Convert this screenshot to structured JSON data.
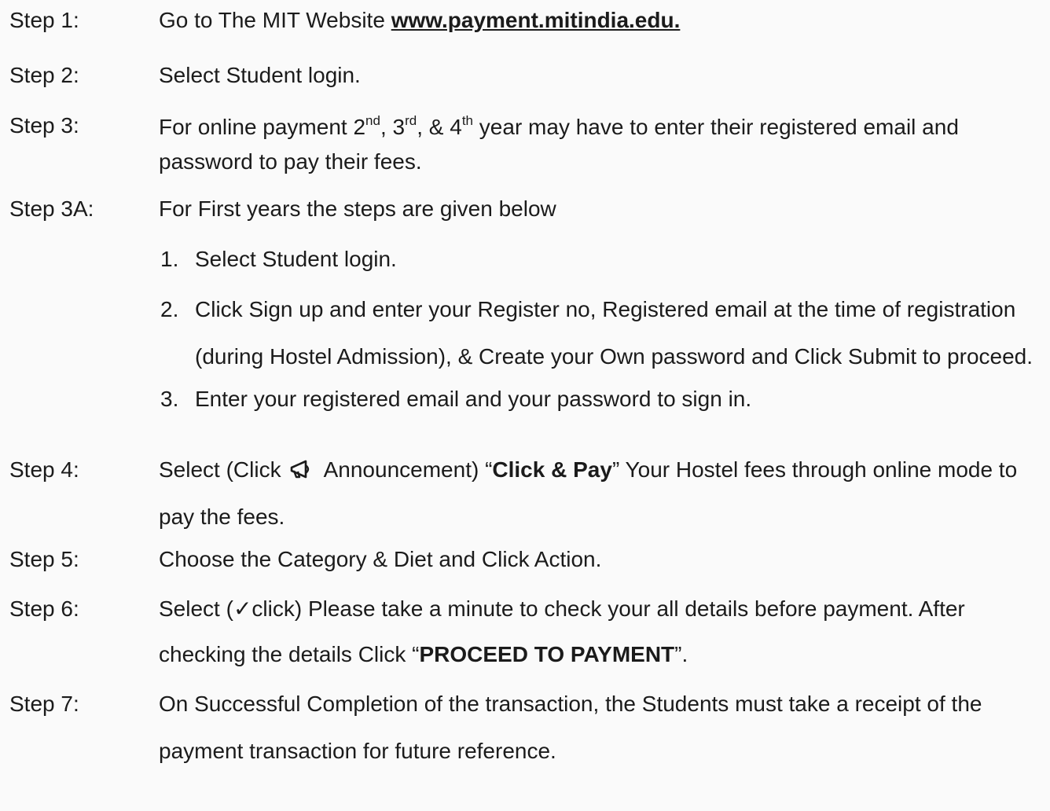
{
  "steps": {
    "s1": {
      "label": "Step 1:",
      "text_before": "Go to The MIT Website ",
      "link": "www.payment.mitindia.edu."
    },
    "s2": {
      "label": "Step 2:",
      "text": "Select Student login."
    },
    "s3": {
      "label": "Step 3:",
      "part1": "For online payment 2",
      "sup1": "nd",
      "part2": ", 3",
      "sup2": "rd",
      "part3": ", & 4",
      "sup3": "th",
      "part4": " year may have to enter their registered email and password to pay their fees."
    },
    "s3a": {
      "label": "Step 3A:",
      "text": "For First years the steps are given below",
      "items": [
        {
          "num": "1.",
          "text": "Select Student login."
        },
        {
          "num": "2.",
          "text": "Click Sign up and enter your Register no, Registered email at the time of registration (during Hostel Admission), & Create your Own password and Click Submit to proceed."
        },
        {
          "num": "3.",
          "text": "Enter your registered email and your password to sign in."
        }
      ]
    },
    "s4": {
      "label": "Step 4:",
      "text_before": "Select (Click ",
      "text_announcement": " Announcement) “",
      "bold": "Click & Pay",
      "text_after": "” Your Hostel fees through online mode to pay the fees."
    },
    "s5": {
      "label": "Step 5:",
      "text": "Choose the Category & Diet and Click Action."
    },
    "s6": {
      "label": "Step 6:",
      "text_before": "Select (",
      "check": "✓",
      "text_middle": "click) Please take a minute to check your all details before payment. After checking the details Click “",
      "bold": "PROCEED TO PAYMENT",
      "text_after": "”."
    },
    "s7": {
      "label": "Step 7:",
      "text": "On Successful Completion of the transaction, the Students must take a receipt of the payment transaction for future reference."
    }
  }
}
